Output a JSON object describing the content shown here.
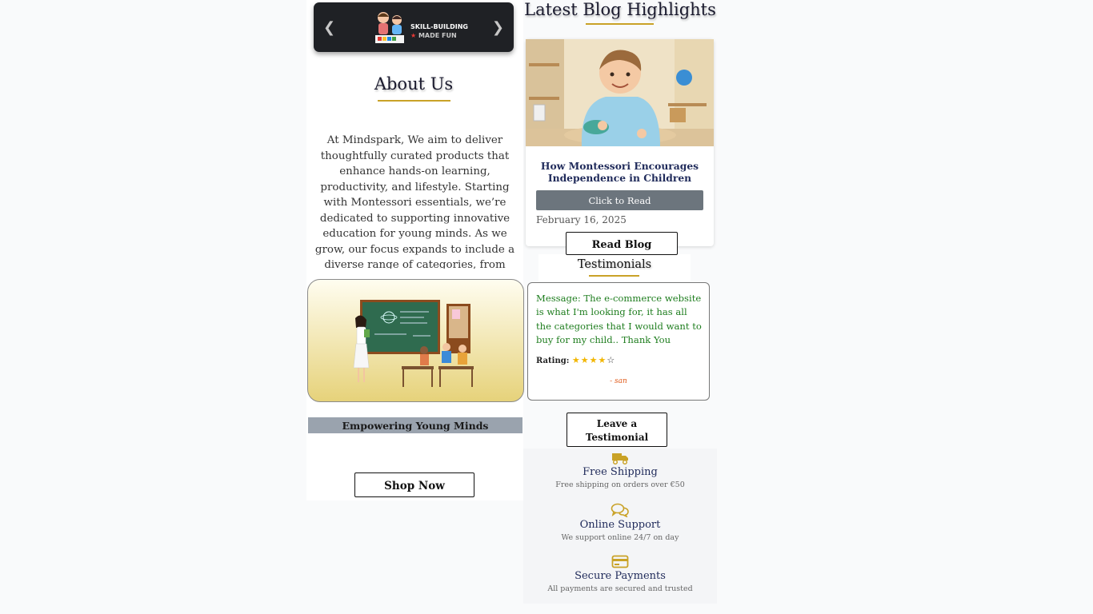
{
  "carousel": {
    "prev_icon": "chevron-left-icon",
    "next_icon": "chevron-right-icon",
    "brand_line1": "SKILL-BUILDING",
    "brand_line2_star": "★",
    "brand_line2": "MADE FUN"
  },
  "about": {
    "title": "About Us",
    "text": "At Mindspark, We aim to deliver thoughtfully curated products that enhance hands-on learning, productivity, and lifestyle. Starting with Montessori essentials, we’re dedicated to supporting innovative education for young minds. As we grow, our focus expands to include a diverse range of categories, from educational toys and teaching tools"
  },
  "promo": {
    "banner": "Empowering Young Minds",
    "shop_button": "Shop Now"
  },
  "blog": {
    "section_title": "Latest Blog Highlights",
    "post_title": "How Montessori Encourages Independence in Children",
    "read_button": "Click to Read",
    "date": "February 16, 2025",
    "read_blog_button": "Read Blog"
  },
  "testimonials": {
    "title": "Testimonials",
    "message": "Message: The e-commerce website is what I'm looking for, it has all the categories that I would want to buy for my child.. Thank You",
    "rating_label": "Rating:",
    "rating_value": 4,
    "rating_max": 5,
    "stars_filled": "★★★★",
    "stars_empty": "☆",
    "author": "- san",
    "leave_button": "Leave a Testimonial"
  },
  "features": [
    {
      "icon": "truck-icon",
      "title": "Free Shipping",
      "desc": "Free shipping on orders over €50"
    },
    {
      "icon": "chat-bubbles-icon",
      "title": "Online Support",
      "desc": "We support online 24/7 on day"
    },
    {
      "icon": "credit-card-icon",
      "title": "Secure Payments",
      "desc": "All payments are secured and trusted"
    }
  ],
  "colors": {
    "accent_gold": "#c9a227",
    "navy_text": "#1f2a5a",
    "testimonial_green": "#1e7d1e",
    "button_gray": "#6c757d"
  }
}
